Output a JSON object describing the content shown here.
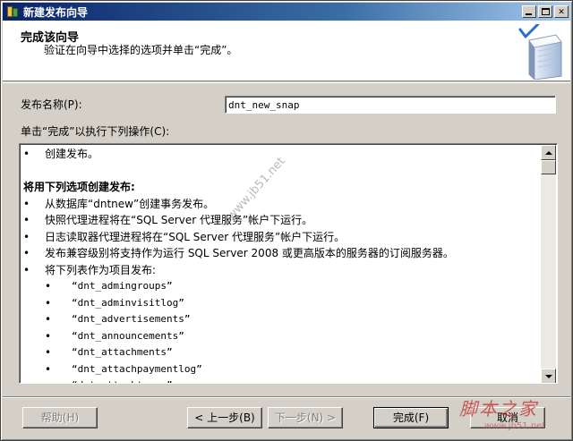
{
  "window": {
    "title": "新建发布向导"
  },
  "header": {
    "title": "完成该向导",
    "subtitle": "验证在向导中选择的选项并单击“完成”。"
  },
  "form": {
    "name_label": "发布名称(P):",
    "name_value": "dnt_new_snap",
    "actions_label": "单击“完成”以执行下列操作(C):"
  },
  "actions": {
    "bullet": "•",
    "lines": [
      {
        "kind": "bullet",
        "text": "创建发布。"
      },
      {
        "kind": "blank",
        "text": ""
      },
      {
        "kind": "heading",
        "text": "将用下列选项创建发布:"
      },
      {
        "kind": "bullet",
        "text": "从数据库“dntnew”创建事务发布。"
      },
      {
        "kind": "bullet",
        "text": "快照代理进程将在“SQL Server 代理服务”帐户下运行。"
      },
      {
        "kind": "bullet",
        "text": "日志读取器代理进程将在“SQL Server 代理服务”帐户下运行。"
      },
      {
        "kind": "bullet",
        "text": "发布兼容级别将支持作为运行 SQL Server 2008 或更高版本的服务器的订阅服务器。"
      },
      {
        "kind": "bullet",
        "text": "将下列表作为项目发布:"
      },
      {
        "kind": "sub",
        "text": "“dnt_admingroups”"
      },
      {
        "kind": "sub",
        "text": "“dnt_adminvisitlog”"
      },
      {
        "kind": "sub",
        "text": "“dnt_advertisements”"
      },
      {
        "kind": "sub",
        "text": "“dnt_announcements”"
      },
      {
        "kind": "sub",
        "text": "“dnt_attachments”"
      },
      {
        "kind": "sub",
        "text": "“dnt_attachpaymentlog”"
      },
      {
        "kind": "sub",
        "text": "“dnt_attachtypes”"
      }
    ]
  },
  "buttons": {
    "help": "帮助(H)",
    "back": "< 上一步(B)",
    "next": "下一步(N) >",
    "finish": "完成(F)",
    "cancel": "取消"
  },
  "watermark": {
    "diagonal": "www.jb51.net",
    "brand": "脚本之家",
    "url": "www.jb51.net"
  },
  "icons": {
    "app": "publication-wizard-icon",
    "header": "book-checkmark-icon"
  }
}
